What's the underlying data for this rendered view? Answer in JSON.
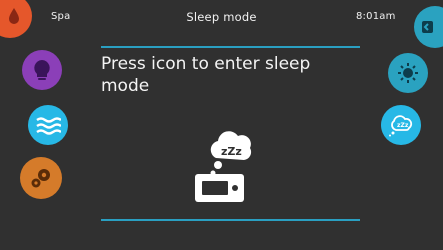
{
  "header": {
    "location_label": "Spa",
    "title": "Sleep mode",
    "time": "8:01am"
  },
  "content": {
    "prompt": "Press icon to enter sleep mode",
    "sleep_icon_text": "zZz"
  },
  "left_menu": [
    {
      "name": "water-care",
      "icon": "droplet-icon",
      "color": "#e5572b"
    },
    {
      "name": "light",
      "icon": "lightbulb-icon",
      "color": "#8b3fb8"
    },
    {
      "name": "heater",
      "icon": "waves-icon",
      "color": "#27b8e6"
    },
    {
      "name": "settings",
      "icon": "gears-icon",
      "color": "#d57b2a"
    }
  ],
  "right_menu": [
    {
      "name": "exit",
      "icon": "exit-icon",
      "color": "#2aa2c0"
    },
    {
      "name": "brightness",
      "icon": "brightness-icon",
      "color": "#2aa2c0"
    },
    {
      "name": "sleep",
      "icon": "sleep-icon",
      "color": "#27b8e6"
    }
  ],
  "colors": {
    "background": "#303030",
    "accent": "#2a9fc1",
    "text": "#f4f4f4"
  }
}
